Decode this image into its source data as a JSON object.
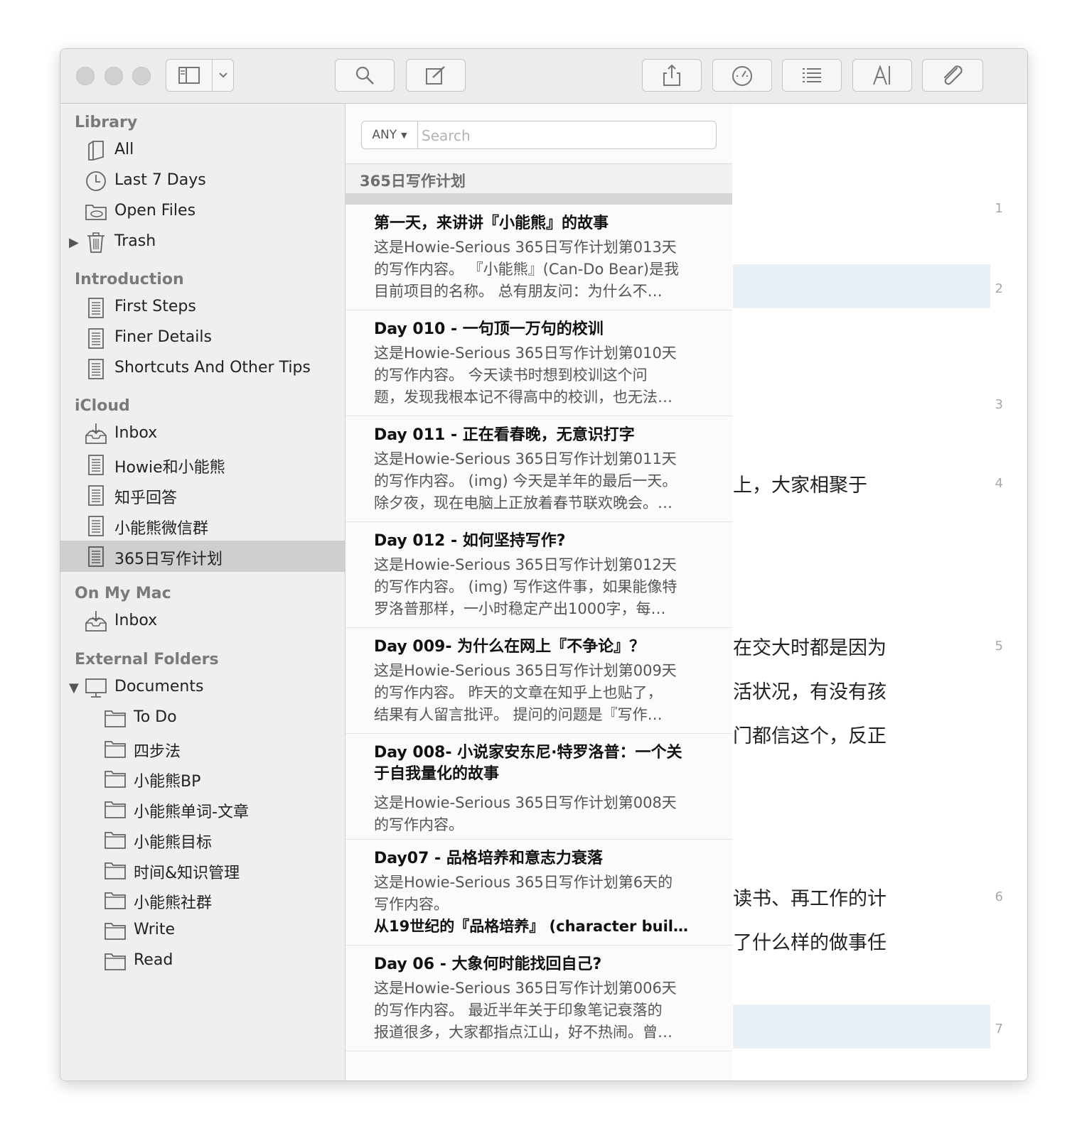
{
  "toolbar": {
    "buttons": [
      "sidebar-toggle",
      "chevron-down",
      "search",
      "compose",
      "share",
      "speedometer",
      "list",
      "font",
      "paperclip"
    ]
  },
  "sidebar": {
    "library": {
      "heading": "Library",
      "items": [
        {
          "label": "All",
          "icon": "book-icon"
        },
        {
          "label": "Last 7 Days",
          "icon": "clock-icon"
        },
        {
          "label": "Open Files",
          "icon": "folder-open-icon"
        },
        {
          "label": "Trash",
          "icon": "trash-icon"
        }
      ]
    },
    "introduction": {
      "heading": "Introduction",
      "items": [
        {
          "label": "First Steps"
        },
        {
          "label": "Finer Details"
        },
        {
          "label": "Shortcuts And Other Tips"
        }
      ]
    },
    "icloud": {
      "heading": "iCloud",
      "items": [
        {
          "label": "Inbox"
        },
        {
          "label": "Howie和小能熊"
        },
        {
          "label": "知乎回答"
        },
        {
          "label": "小能熊微信群"
        },
        {
          "label": "365日写作计划"
        }
      ]
    },
    "onmymac": {
      "heading": "On My Mac",
      "items": [
        {
          "label": "Inbox"
        }
      ]
    },
    "external": {
      "heading": "External Folders",
      "root": "Documents",
      "folders": [
        "To Do",
        "四步法",
        "小能熊BP",
        "小能熊单词-文章",
        "小能熊目标",
        "时间&知识管理",
        "小能熊社群",
        "Write",
        "Read"
      ]
    }
  },
  "list": {
    "search": {
      "scope": "ANY",
      "placeholder": "Search"
    },
    "header": "365日写作计划",
    "notes": [
      {
        "title": "第一天，来讲讲『小能熊』的故事",
        "lines": [
          "这是Howie-Serious 365日写作计划第013天",
          "的写作内容。 『小能熊』(Can-Do Bear)是我",
          "目前项目的名称。 总有朋友问：为什么不…"
        ]
      },
      {
        "title": "Day 010 - 一句顶一万句的校训",
        "lines": [
          "这是Howie-Serious 365日写作计划第010天",
          "的写作内容。 今天读书时想到校训这个问",
          "题，发现我根本记不得高中的校训，也无法…"
        ]
      },
      {
        "title": "Day 011 - 正在看春晚，无意识打字",
        "lines": [
          "这是Howie-Serious 365日写作计划第011天",
          "的写作内容。 (img) 今天是羊年的最后一天。",
          "除夕夜，现在电脑上正放着春节联欢晚会。…"
        ]
      },
      {
        "title": "Day 012 - 如何坚持写作?",
        "lines": [
          "这是Howie-Serious 365日写作计划第012天",
          "的写作内容。 (img) 写作这件事，如果能像特",
          "罗洛普那样，一小时稳定产出1000字，每…"
        ]
      },
      {
        "title": "Day 009- 为什么在网上『不争论』？",
        "lines": [
          "这是Howie-Serious 365日写作计划第009天",
          "的写作内容。 昨天的文章在知乎上也贴了，",
          "结果有人留言批评。 提问的问题是『写作…"
        ]
      },
      {
        "title": "Day 008- 小说家安东尼·特罗洛普：一个关\n于自我量化的故事",
        "lines": [
          "这是Howie-Serious 365日写作计划第008天",
          "的写作内容。"
        ]
      },
      {
        "title": "Day07 - 品格培养和意志力衰落",
        "lines": [
          "这是Howie-Serious 365日写作计划第6天的",
          "写作内容。"
        ],
        "bold_line": "从19世纪的『品格培养』 (character buil…"
      },
      {
        "title": "Day 06 - 大象何时能找回自己?",
        "lines": [
          "这是Howie-Serious 365日写作计划第006天",
          "的写作内容。 最近半年关于印象笔记衰落的",
          "报道很多，大家都指点江山，好不热闹。曾…"
        ]
      }
    ]
  },
  "editor": {
    "line_numbers": [
      "1",
      "2",
      "3",
      "4",
      "5",
      "6",
      "7"
    ],
    "fragments": [
      "上，大家相聚于",
      "在交大时都是因为",
      "活状况，有没有孩",
      "门都信这个，反正",
      "读书、再工作的计",
      "了什么样的做事任"
    ]
  }
}
